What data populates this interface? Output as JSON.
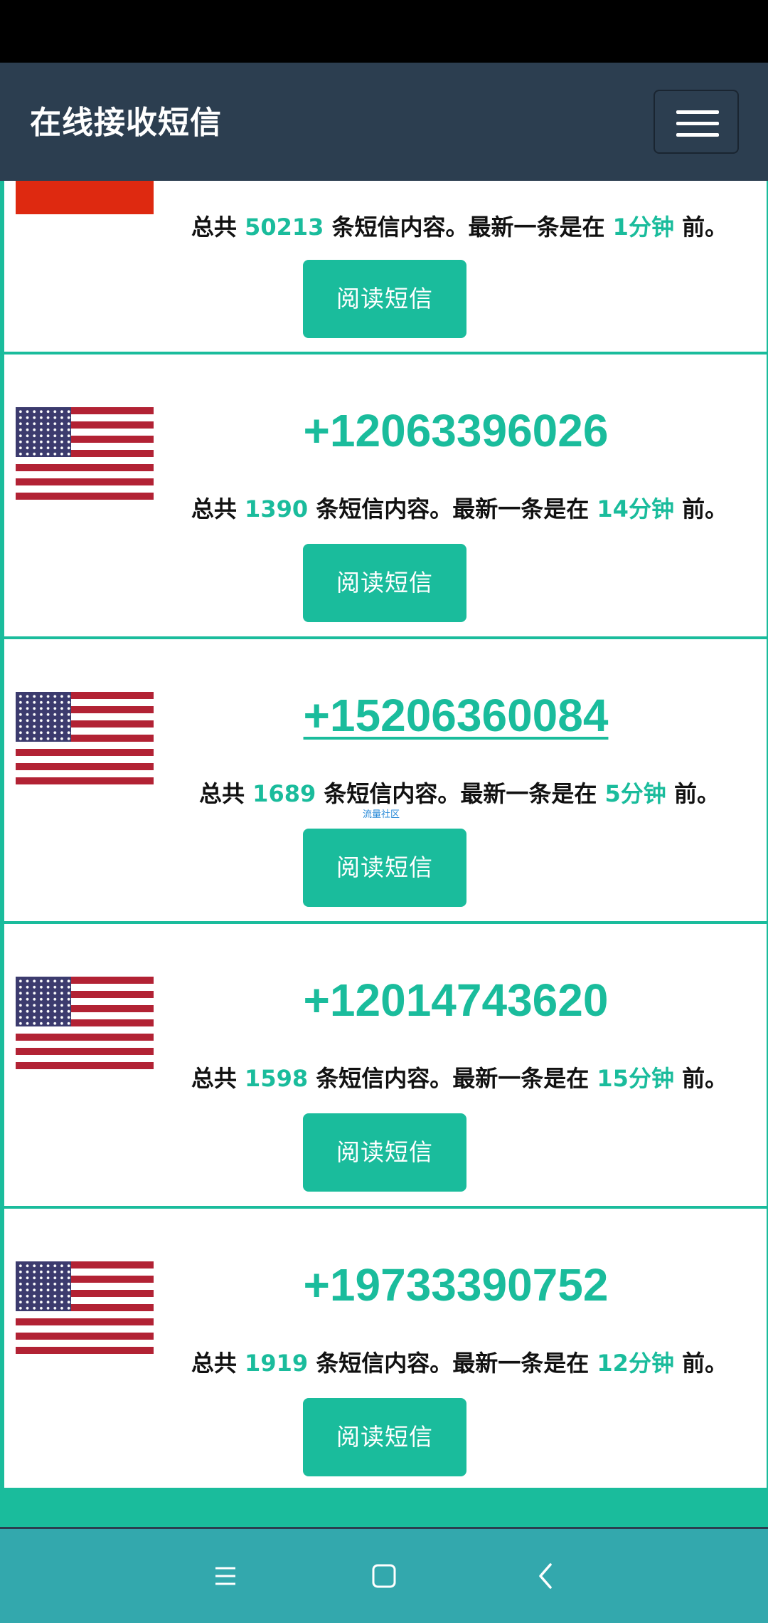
{
  "navbar": {
    "brand": "在线接收短信"
  },
  "cards": [
    {
      "flag": "CN",
      "total_prefix": "总共",
      "count": "50213",
      "middle": "条短信内容。最新一条是在",
      "time": "1分钟",
      "suffix": "前。",
      "button": "阅读短信"
    },
    {
      "flag": "US",
      "phone": "+12063396026",
      "total_prefix": "总共",
      "count": "1390",
      "middle": "条短信内容。最新一条是在",
      "time": "14分钟",
      "suffix": "前。",
      "button": "阅读短信"
    },
    {
      "flag": "US",
      "phone": "+15206360084",
      "total_prefix": "总共",
      "count": "1689",
      "middle": "条短信内容。最新一条是在",
      "time": "5分钟",
      "suffix": "前。",
      "button": "阅读短信"
    },
    {
      "flag": "US",
      "phone": "+12014743620",
      "total_prefix": "总共",
      "count": "1598",
      "middle": "条短信内容。最新一条是在",
      "time": "15分钟",
      "suffix": "前。",
      "button": "阅读短信"
    },
    {
      "flag": "US",
      "phone": "+19733390752",
      "total_prefix": "总共",
      "count": "1919",
      "middle": "条短信内容。最新一条是在",
      "time": "12分钟",
      "suffix": "前。",
      "button": "阅读短信"
    }
  ],
  "watermark": "流量社区",
  "icons": {
    "menu": "hamburger-icon",
    "recents": "recents-icon",
    "home": "home-icon",
    "back": "back-icon"
  },
  "colors": {
    "accent": "#1abc9c",
    "navbar": "#2c3e50",
    "system_nav": "#33a8ad"
  }
}
